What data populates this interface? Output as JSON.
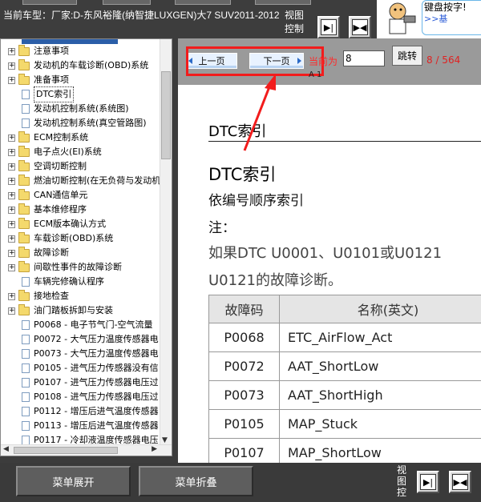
{
  "header": {
    "car_title": "当前车型：厂家:D-东风裕隆(纳智捷LUXGEN)大7 SUV2011-2012",
    "view_control": "视图控制",
    "prev_icon": "arrow-right-bar-icon",
    "next_icon": "double-arrow-icon",
    "help_text": "键盘按字!",
    "help_link": ">>基"
  },
  "sidebar": {
    "items": [
      {
        "label": "注意事项",
        "type": "folder"
      },
      {
        "label": "发动机的车载诊断(OBD)系统",
        "type": "folder"
      },
      {
        "label": "准备事项",
        "type": "folder"
      },
      {
        "label": "DTC索引",
        "type": "page",
        "selected": true
      },
      {
        "label": "发动机控制系统(系统图)",
        "type": "page"
      },
      {
        "label": "发动机控制系统(真空管路图)",
        "type": "page"
      },
      {
        "label": "ECM控制系统",
        "type": "folder"
      },
      {
        "label": "电子点火(EI)系统",
        "type": "folder"
      },
      {
        "label": "空调切断控制",
        "type": "folder"
      },
      {
        "label": "燃油切断控制(在无负荷与发动机",
        "type": "folder"
      },
      {
        "label": "CAN通信单元",
        "type": "folder"
      },
      {
        "label": "基本维修程序",
        "type": "folder"
      },
      {
        "label": "ECM版本确认方式",
        "type": "folder"
      },
      {
        "label": "车载诊断(OBD)系统",
        "type": "folder"
      },
      {
        "label": "故障诊断",
        "type": "folder"
      },
      {
        "label": "间歇性事件的故障诊断",
        "type": "folder"
      },
      {
        "label": "车辆完修确认程序",
        "type": "page"
      },
      {
        "label": "接地检查",
        "type": "folder"
      },
      {
        "label": "油门踏板拆卸与安装",
        "type": "folder"
      },
      {
        "label": "P0068 - 电子节气门-空气流量",
        "type": "page"
      },
      {
        "label": "P0072 - 大气压力温度传感器电",
        "type": "page"
      },
      {
        "label": "P0073 - 大气压力温度传感器电",
        "type": "page"
      },
      {
        "label": "P0105 - 进气压力传感器没有信",
        "type": "page"
      },
      {
        "label": "P0107 - 进气压力传感器电压过",
        "type": "page"
      },
      {
        "label": "P0108 - 进气压力传感器电压过",
        "type": "page"
      },
      {
        "label": "P0112 - 增压后进气温度传感器",
        "type": "page"
      },
      {
        "label": "P0113 - 增压后进气温度传感器",
        "type": "page"
      },
      {
        "label": "P0117 - 冷却液温度传感器电压",
        "type": "page"
      }
    ]
  },
  "page_nav": {
    "prev_label": "上一页",
    "next_label": "下一页",
    "current_label": "当前为",
    "current_value": "8",
    "goto_label": "跳转",
    "page_count": "8 / 564",
    "small_text": "A 1"
  },
  "document": {
    "header_title": "DTC索引",
    "title": "DTC索引",
    "subtitle": "依编号顺序索引",
    "note": "注：",
    "para1": "如果DTC U0001、U0101或U0121",
    "para2": "U0121的故障诊断。",
    "table": {
      "headers": [
        "故障码",
        "名称(英文)"
      ],
      "rows": [
        [
          "P0068",
          "ETC_AirFlow_Act"
        ],
        [
          "P0072",
          "AAT_ShortLow"
        ],
        [
          "P0073",
          "AAT_ShortHigh"
        ],
        [
          "P0105",
          "MAP_Stuck"
        ],
        [
          "P0107",
          "MAP_ShortLow"
        ]
      ]
    }
  },
  "footer": {
    "expand_label": "菜单展开",
    "collapse_label": "菜单折叠",
    "view_control": "视图控"
  },
  "colors": {
    "annotation": "#f21c1c",
    "page_count": "#e02222",
    "toolbar": "#9a9a9a"
  }
}
